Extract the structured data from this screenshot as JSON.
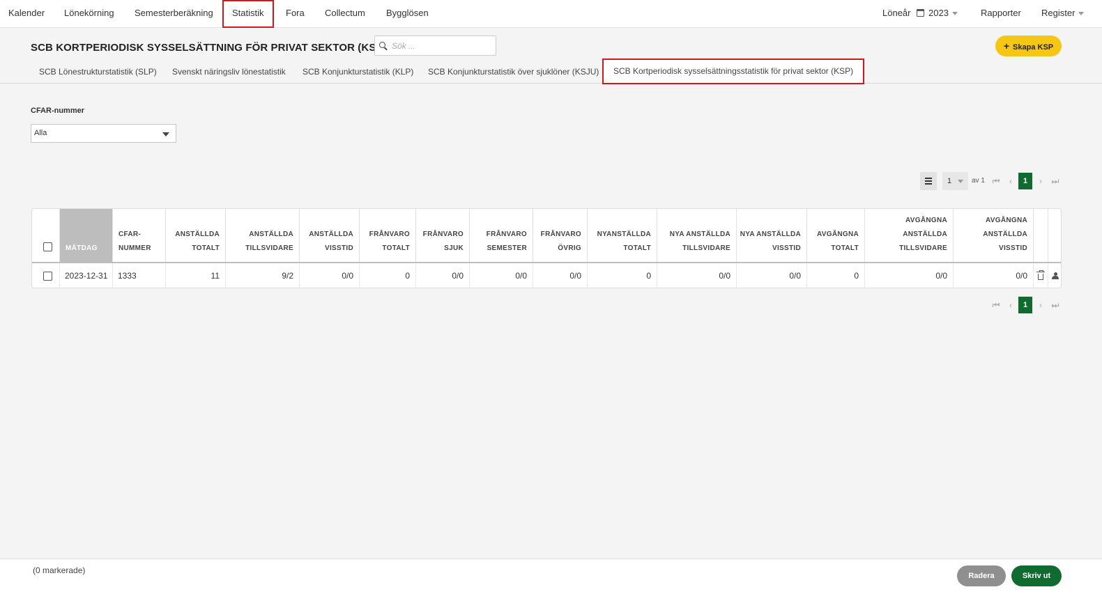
{
  "nav": {
    "items": [
      "Kalender",
      "Lönekörning",
      "Semesterberäkning",
      "Statistik",
      "Fora",
      "Collectum",
      "Bygglösen"
    ],
    "year_label": "Löneår",
    "year_value": "2023",
    "reports": "Rapporter",
    "register": "Register"
  },
  "header": {
    "title": "SCB KORTPERIODISK SYSSELSÄTTNING FÖR PRIVAT SEKTOR (KSP)",
    "search_placeholder": "Sök ...",
    "create_label": "Skapa KSP"
  },
  "tabs": [
    "SCB Lönestrukturstatistik (SLP)",
    "Svenskt näringsliv lönestatistik",
    "SCB Konjunkturstatistik (KLP)",
    "SCB Konjunkturstatistik över sjuklöner (KSJU)",
    "SCB Kortperiodisk sysselsättningsstatistik för privat sektor (KSP)"
  ],
  "filter": {
    "label": "CFAR-nummer",
    "value": "Alla"
  },
  "pager": {
    "page": "1",
    "of_label": "av 1",
    "current": "1"
  },
  "table": {
    "columns": [
      [
        "MÄTDAG"
      ],
      [
        "CFAR-",
        "NUMMER"
      ],
      [
        "ANSTÄLLDA",
        "TOTALT"
      ],
      [
        "ANSTÄLLDA",
        "TILLSVIDARE"
      ],
      [
        "ANSTÄLLDA",
        "VISSTID"
      ],
      [
        "FRÅNVARO",
        "TOTALT"
      ],
      [
        "FRÅNVARO",
        "SJUK"
      ],
      [
        "FRÅNVARO",
        "SEMESTER"
      ],
      [
        "FRÅNVARO",
        "ÖVRIG"
      ],
      [
        "NYANSTÄLLDA",
        "TOTALT"
      ],
      [
        "NYA ANSTÄLLDA",
        "TILLSVIDARE"
      ],
      [
        "NYA ANSTÄLLDA",
        "VISSTID"
      ],
      [
        "AVGÅNGNA",
        "TOTALT"
      ],
      [
        "AVGÅNGNA",
        "ANSTÄLLDA",
        "TILLSVIDARE"
      ],
      [
        "AVGÅNGNA",
        "ANSTÄLLDA",
        "VISSTID"
      ]
    ],
    "rows": [
      [
        "2023-12-31",
        "1333",
        "11",
        "9/2",
        "0/0",
        "0",
        "0/0",
        "0/0",
        "0/0",
        "0",
        "0/0",
        "0/0",
        "0",
        "0/0",
        "0/0"
      ]
    ]
  },
  "footer": {
    "selected": "(0 markerade)",
    "delete_label": "Radera",
    "print_label": "Skriv ut"
  },
  "colors": {
    "accent_yellow": "#f6c614",
    "primary_green": "#0f6b2f",
    "highlight_red": "#d0191e",
    "disabled_gray": "#8f8f8f"
  }
}
